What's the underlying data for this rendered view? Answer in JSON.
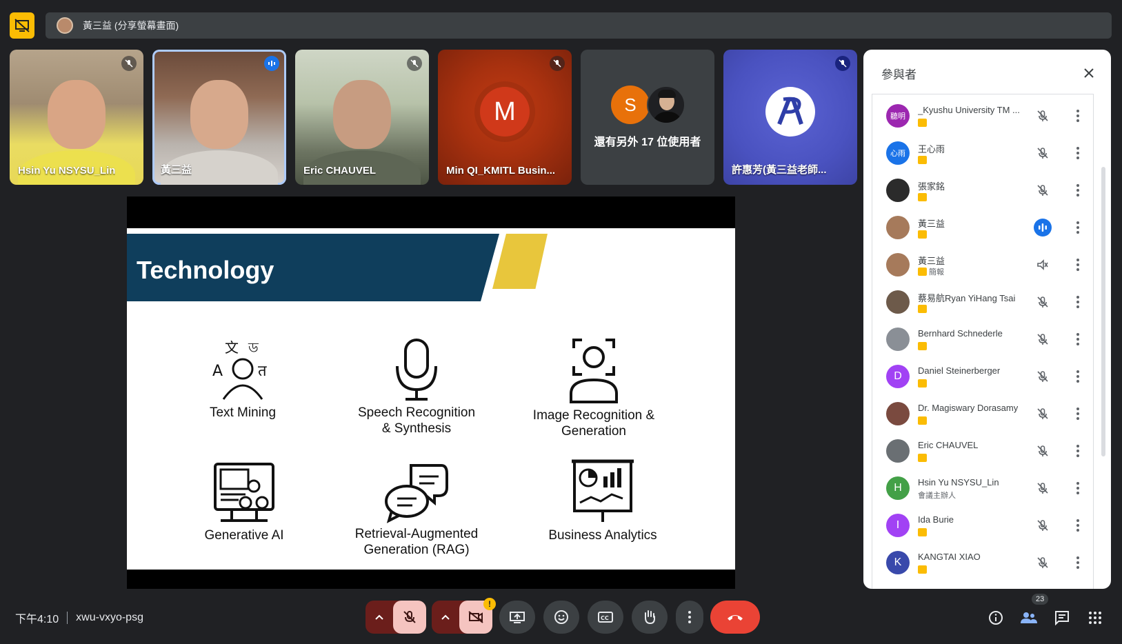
{
  "presenter_bar": {
    "label": "黃三益 (分享螢幕畫面)"
  },
  "tiles": [
    {
      "name": "Hsin Yu NSYSU_Lin",
      "mic": "muted"
    },
    {
      "name": "黃三益",
      "mic": "speaking"
    },
    {
      "name": "Eric CHAUVEL",
      "mic": "muted"
    },
    {
      "name": "Min QI_KMITL Busin...",
      "mic": "muted",
      "initial": "M"
    },
    {
      "name": "還有另外 17 位使用者",
      "initial": "S"
    },
    {
      "name": "許惠芳(黃三益老師...",
      "mic": "muted"
    }
  ],
  "slide": {
    "title": "Technology",
    "items": [
      {
        "label_1": "Text Mining",
        "label_2": "",
        "icon": "translate-person-icon"
      },
      {
        "label_1": "Speech Recognition",
        "label_2": "& Synthesis",
        "icon": "microphone-icon"
      },
      {
        "label_1": "Image Recognition &",
        "label_2": "Generation",
        "icon": "face-scan-icon"
      },
      {
        "label_1": "Generative AI",
        "label_2": "",
        "icon": "ai-monitor-icon"
      },
      {
        "label_1": "Retrieval-Augmented",
        "label_2": "Generation (RAG)",
        "icon": "chat-bubbles-icon"
      },
      {
        "label_1": "Business Analytics",
        "label_2": "",
        "icon": "analytics-board-icon"
      }
    ]
  },
  "panel": {
    "title": "參與者",
    "participants": [
      {
        "name": "_Kyushu University TM ...",
        "sub": "",
        "avatar_text": "聽明",
        "avatar_color": "#9c27b0",
        "mic": "muted"
      },
      {
        "name": "王心雨",
        "sub": "",
        "avatar_text": "心雨",
        "avatar_color": "#1a73e8",
        "mic": "muted"
      },
      {
        "name": "張家銘",
        "sub": "",
        "avatar_text": "",
        "avatar_color": "#2b2b2b",
        "mic": "muted"
      },
      {
        "name": "黃三益",
        "sub": "",
        "avatar_text": "",
        "avatar_color": "#a67a5b",
        "mic": "speaking"
      },
      {
        "name": "黃三益",
        "sub": "簡報",
        "avatar_text": "",
        "avatar_color": "#a67a5b",
        "mic": "presenting"
      },
      {
        "name": "蔡易航Ryan YiHang Tsai",
        "sub": "",
        "avatar_text": "",
        "avatar_color": "#6d5a4a",
        "mic": "muted"
      },
      {
        "name": "Bernhard Schnederle",
        "sub": "",
        "avatar_text": "",
        "avatar_color": "#8a8f96",
        "mic": "muted"
      },
      {
        "name": "Daniel Steinerberger",
        "sub": "",
        "avatar_text": "D",
        "avatar_color": "#a142f4",
        "mic": "muted"
      },
      {
        "name": "Dr. Magiswary Dorasamy",
        "sub": "",
        "avatar_text": "",
        "avatar_color": "#7a4a3f",
        "mic": "muted"
      },
      {
        "name": "Eric CHAUVEL",
        "sub": "",
        "avatar_text": "",
        "avatar_color": "#6a6f73",
        "mic": "muted"
      },
      {
        "name": "Hsin Yu NSYSU_Lin",
        "sub": "會議主辦人",
        "avatar_text": "H",
        "avatar_color": "#43a047",
        "mic": "muted"
      },
      {
        "name": "Ida Burie",
        "sub": "",
        "avatar_text": "I",
        "avatar_color": "#a142f4",
        "mic": "muted"
      },
      {
        "name": "KANGTAI XIAO",
        "sub": "",
        "avatar_text": "K",
        "avatar_color": "#3949ab",
        "mic": "muted"
      }
    ]
  },
  "bottom": {
    "time": "下午4:10",
    "meeting_code": "xwu-vxyo-psg",
    "people_count": "23",
    "warning": "!"
  },
  "colors": {
    "background": "#202124",
    "tile": "#3c4043",
    "accent_blue": "#1a73e8",
    "present_yellow": "#fbbc04",
    "end_call_red": "#ea4335"
  }
}
